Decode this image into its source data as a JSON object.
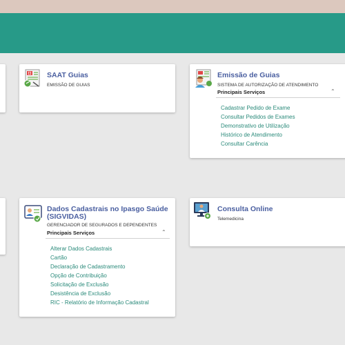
{
  "cards": {
    "saat": {
      "title": "SAAT Guias",
      "subtitle": "EMISSÃO DE GUIAS"
    },
    "emissao": {
      "title": "Emissão de Guias",
      "subtitle": "SISTEMA DE AUTORIZAÇÃO DE ATENDIMENTO",
      "services_label": "Principais Serviços",
      "chevron": "⌃",
      "links": [
        "Cadastrar Pedido de Exame",
        "Consultar Pedidos de Exames",
        "Demonstrativo de Utilização",
        "Histórico de Atendimento",
        "Consultar Carência"
      ]
    },
    "dados": {
      "title_line1": "Dados Cadastrais no Ipasgo Saúde",
      "title_line2": "(SIGVIDAS)",
      "subtitle": "GERENCIADOR DE SEGURADOS E DEPENDENTES",
      "services_label": "Principais Serviços",
      "chevron": "⌃",
      "links": [
        "Alterar Dados Cadastrais",
        "Cartão",
        "Declaração de Cadastramento",
        "Opção de Contribuição",
        "Solicitação de Exclusão",
        "Desistência de Exclusão",
        "RIC - Relatório de Informação Cadastral"
      ]
    },
    "consulta": {
      "title": "Consulta Online",
      "subtitle": "Telemedicina"
    }
  },
  "colors": {
    "header": "#279a88",
    "top_strip": "#dcc8be",
    "title": "#4a5fa0",
    "link": "#2a8a7a"
  }
}
